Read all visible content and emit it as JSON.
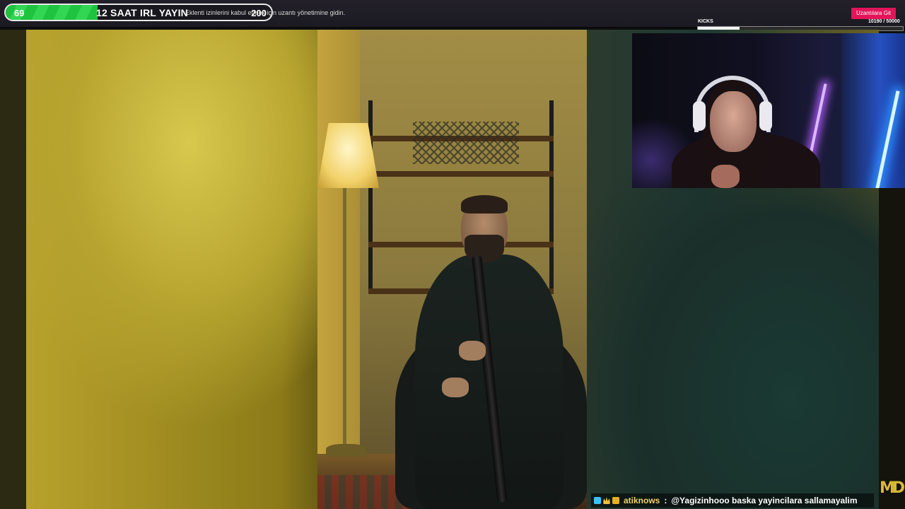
{
  "goal": {
    "current": "69",
    "title": "12 SAAT IRL YAYIN",
    "target": "200",
    "progress_fraction": 0.345,
    "fill_color": "#1fc33f"
  },
  "extension_notice": "Eklenti izinlerini kabul etmek için uzantı yönetimine gidin.",
  "extensions_button": "Uzantılara Git",
  "kicks": {
    "label": "KICKS",
    "current": 10190,
    "total": 50000,
    "count_text": "10190  / 50000"
  },
  "chat": {
    "badges": [
      "verified-badge-icon",
      "crown-badge-icon",
      "gift-badge-icon"
    ],
    "username": "atiknows",
    "separator": ":",
    "message": "@Yagizinhooo baska yayincilara sallamayalim",
    "username_color": "#f3d06a"
  },
  "corner_logo": "MD",
  "colors": {
    "accent_button": "#e2145a",
    "topbar": "#1b1a22"
  }
}
